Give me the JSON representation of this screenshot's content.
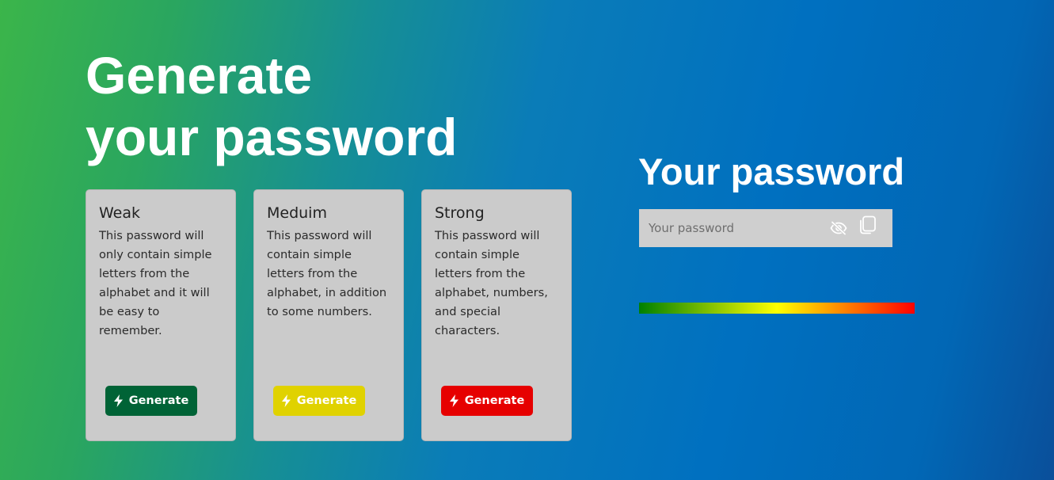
{
  "hero": {
    "line1": "Generate",
    "line2": "your password"
  },
  "cards": [
    {
      "title": "Weak",
      "description": "This password will only contain simple letters from the alphabet and it will be easy to remember.",
      "button_label": "Generate",
      "button_color": "#006336"
    },
    {
      "title": "Meduim",
      "description": "This password will contain simple letters from the alphabet, in addition to some numbers.",
      "button_label": "Generate",
      "button_color": "#e0d200"
    },
    {
      "title": "Strong",
      "description": "This password will contain simple letters from the alphabet, numbers, and special characters.",
      "button_label": "Generate",
      "button_color": "#e60000"
    }
  ],
  "password_panel": {
    "title": "Your password",
    "input_placeholder": "Your password",
    "input_value": "",
    "visibility_icon": "eye-slash-icon",
    "copy_icon": "copy-icon",
    "strength_colors": [
      "#008000",
      "#ffff00",
      "#ff0000"
    ]
  },
  "background": {
    "gradient_start": "#3bb54a",
    "gradient_end": "#0a4f9a"
  },
  "icons": {
    "button_icon": "lightning-bolt-icon"
  }
}
